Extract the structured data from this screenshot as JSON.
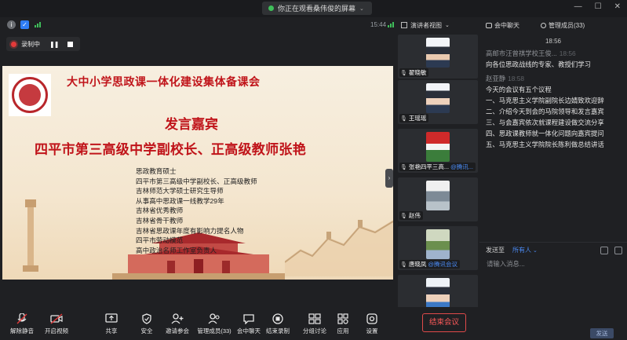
{
  "titlebar": {
    "share_notice": "你正在观看桑伟俊的屏幕",
    "window_controls": [
      "minimize-icon",
      "maximize-icon",
      "close-icon"
    ]
  },
  "status": {
    "time": "15:44"
  },
  "recording": {
    "label": "录制中"
  },
  "slide": {
    "title": "大中小学思政课一体化建设集体备课会",
    "guest_heading": "发言嘉宾",
    "speaker": "四平市第三高级中学副校长、正高级教师张艳",
    "bio_lines": [
      "思政教育硕士",
      "四平市第三高级中学副校长、正高级教师",
      "吉林师范大学硕士研究生导师",
      "从事高中思政课一线教学29年",
      "吉林省优秀教师",
      "吉林省骨干教师",
      "吉林省思政课年度有影响力提名人物",
      "四平市劳动模范",
      "高中政治名师工作室负责人"
    ]
  },
  "video_panel": {
    "view_label": "演讲者视图",
    "participants": [
      {
        "name": "翟晓敏",
        "tag": ""
      },
      {
        "name": "王瑶瑶",
        "tag": ""
      },
      {
        "name": "张艳四平三高...",
        "tag": "@腾讯..."
      },
      {
        "name": "赵伟",
        "tag": ""
      },
      {
        "name": "唐晓凤",
        "tag": "@腾讯会议"
      },
      {
        "name": "",
        "tag": ""
      }
    ]
  },
  "chat_panel": {
    "tab_chat": "会中聊天",
    "tab_members": "管理成员(33)",
    "timestamp": "18:56",
    "messages": [
      {
        "sender": "高邮市汪曾祺学校王俊...",
        "time": "18:56",
        "lines": [
          "向各位思政战线的专家、教授们学习"
        ]
      },
      {
        "sender": "赵亚静",
        "time": "18:58",
        "lines": [
          "今天的会议有五个议程",
          "一、马克思主义学院副院长边婧致欢迎辞",
          "二、介绍今天到会的马院领导和发言嘉宾",
          "三、与会嘉宾依次就课程建设做交流分享",
          "四、思政课教师就一体化问题向嘉宾提问",
          "五、马克思主义学院院长陈利做总结讲话"
        ]
      }
    ],
    "send_to_label": "发送至",
    "send_to_target": "所有人",
    "input_placeholder": "请输入消息...",
    "send_button": "发送"
  },
  "toolbar": {
    "mute": "解除静音",
    "video": "开启视频",
    "share": "共享",
    "security": "安全",
    "invite": "邀请参会",
    "members": "管理成员(33)",
    "chat": "会中聊天",
    "record": "结束录制",
    "breakout": "分组讨论",
    "apps": "应用",
    "settings": "设置",
    "end": "结束会议"
  },
  "colors": {
    "slide_red": "#c0141a",
    "accent_blue": "#4b8bf5",
    "end_red": "#ff5a5a"
  }
}
